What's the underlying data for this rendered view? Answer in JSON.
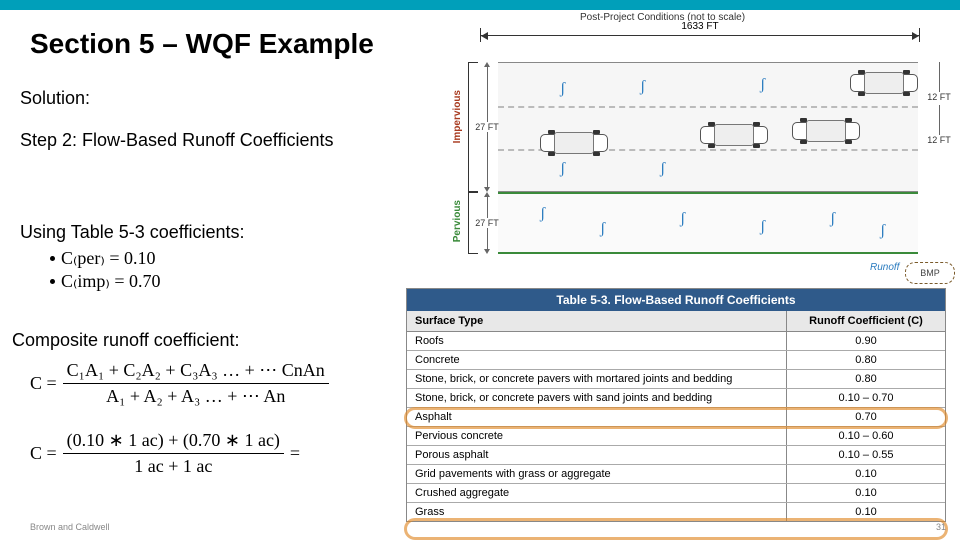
{
  "title": "Section 5 – WQF Example",
  "solution_label": "Solution:",
  "step_label": "Step 2: Flow-Based Runoff Coefficients",
  "using_label": "Using Table 5-3 coefficients:",
  "composite_label": "Composite runoff coefficient:",
  "coeffs": {
    "per_expr": "C₍per₎ = 0.10",
    "imp_expr": "C₍imp₎ = 0.70"
  },
  "formula_general": {
    "lhs": "C =",
    "num": "C₁A₁ + C₂A₂ + C₃A₃ … + ⋯ CnAn",
    "den": "A₁ + A₂ + A₃ … + ⋯ An"
  },
  "formula_plugged": {
    "lhs": "C =",
    "num": "(0.10 ∗ 1 ac) + (0.70 ∗ 1 ac)",
    "den": "1 ac + 1 ac",
    "eq": "="
  },
  "diagram": {
    "caption": "Post-Project Conditions (not to scale)",
    "width_label": "1633 FT",
    "imp_label": "Impervious",
    "per_label": "Pervious",
    "depth_imp": "27 FT",
    "depth_per": "27 FT",
    "lane_ft": "12 FT",
    "runoff_label": "Runoff",
    "bmp_label": "BMP"
  },
  "table": {
    "title": "Table 5-3.  Flow-Based Runoff Coefficients",
    "head_surface": "Surface Type",
    "head_coeff": "Runoff Coefficient (C)",
    "rows": [
      {
        "surface": "Roofs",
        "c": "0.90"
      },
      {
        "surface": "Concrete",
        "c": "0.80"
      },
      {
        "surface": "Stone, brick, or concrete pavers with mortared joints and bedding",
        "c": "0.80"
      },
      {
        "surface": "Stone, brick, or concrete pavers with sand joints and bedding",
        "c": "0.10 – 0.70"
      },
      {
        "surface": "Asphalt",
        "c": "0.70"
      },
      {
        "surface": "Pervious concrete",
        "c": "0.10 – 0.60"
      },
      {
        "surface": "Porous asphalt",
        "c": "0.10 – 0.55"
      },
      {
        "surface": "Grid pavements with grass or aggregate",
        "c": "0.10"
      },
      {
        "surface": "Crushed aggregate",
        "c": "0.10"
      },
      {
        "surface": "Grass",
        "c": "0.10"
      }
    ]
  },
  "footer": {
    "left": "Brown and Caldwell",
    "page": "31"
  }
}
